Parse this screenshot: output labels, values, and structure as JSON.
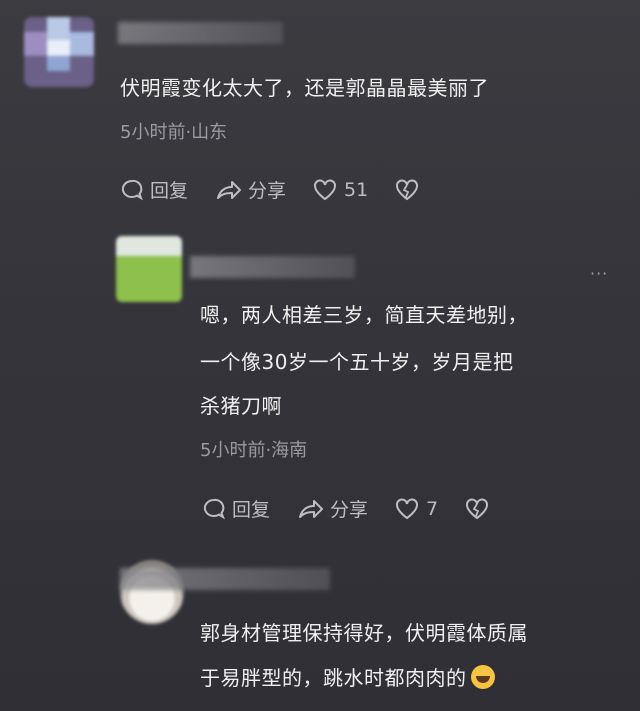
{
  "comments": [
    {
      "text": "伏明霞变化太大了，还是郭晶晶最美丽了",
      "meta": "5小时前·山东",
      "reply_label": "回复",
      "share_label": "分享",
      "likes": "51"
    },
    {
      "lines": [
        "嗯，两人相差三岁，简直天差地别，",
        "一个像30岁一个五十岁，岁月是把",
        "杀猪刀啊"
      ],
      "meta": "5小时前·海南",
      "reply_label": "回复",
      "share_label": "分享",
      "likes": "7",
      "more": "···"
    },
    {
      "lines": [
        "郭身材管理保持得好，伏明霞体质属",
        "于易胖型的，跳水时都肉肉的"
      ],
      "emoji": "grinning-tears-emoji"
    }
  ]
}
